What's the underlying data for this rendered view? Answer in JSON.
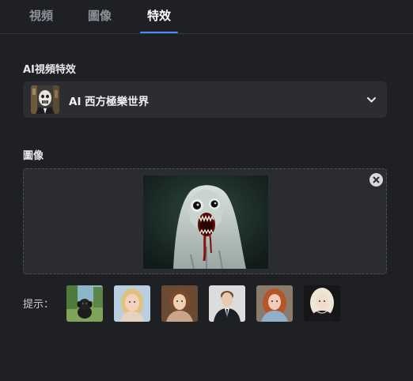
{
  "tabs": [
    {
      "label": "視頻"
    },
    {
      "label": "圖像"
    },
    {
      "label": "特效"
    }
  ],
  "effect_section": {
    "label": "AI視頻特效",
    "selected": "AI 西方極樂世界",
    "chevron_icon": "chevron-down-icon"
  },
  "image_section": {
    "label": "圖像",
    "close_icon": "close-circle-icon"
  },
  "hints": {
    "label": "提示：",
    "items": [
      {
        "name": "black-puppy"
      },
      {
        "name": "blonde-girl"
      },
      {
        "name": "vintage-woman"
      },
      {
        "name": "man-in-suit"
      },
      {
        "name": "redhead-woman"
      },
      {
        "name": "platinum-blonde-woman"
      }
    ]
  },
  "colors": {
    "background": "#1f2024",
    "panel": "#2c2d33",
    "accent": "#4a8cff",
    "tab_inactive": "#8d9099"
  }
}
